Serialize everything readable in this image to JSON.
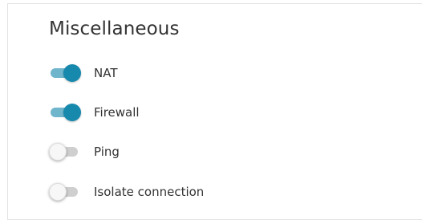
{
  "section": {
    "title": "Miscellaneous"
  },
  "toggles": [
    {
      "label": "NAT",
      "state": true
    },
    {
      "label": "Firewall",
      "state": true
    },
    {
      "label": "Ping",
      "state": false
    },
    {
      "label": "Isolate connection",
      "state": false
    }
  ],
  "colors": {
    "switch_on_knob": "#1789ad",
    "switch_on_track": "#6fb5cc",
    "switch_off_track": "#cfcfcf",
    "switch_off_knob": "#f7f7f7"
  }
}
